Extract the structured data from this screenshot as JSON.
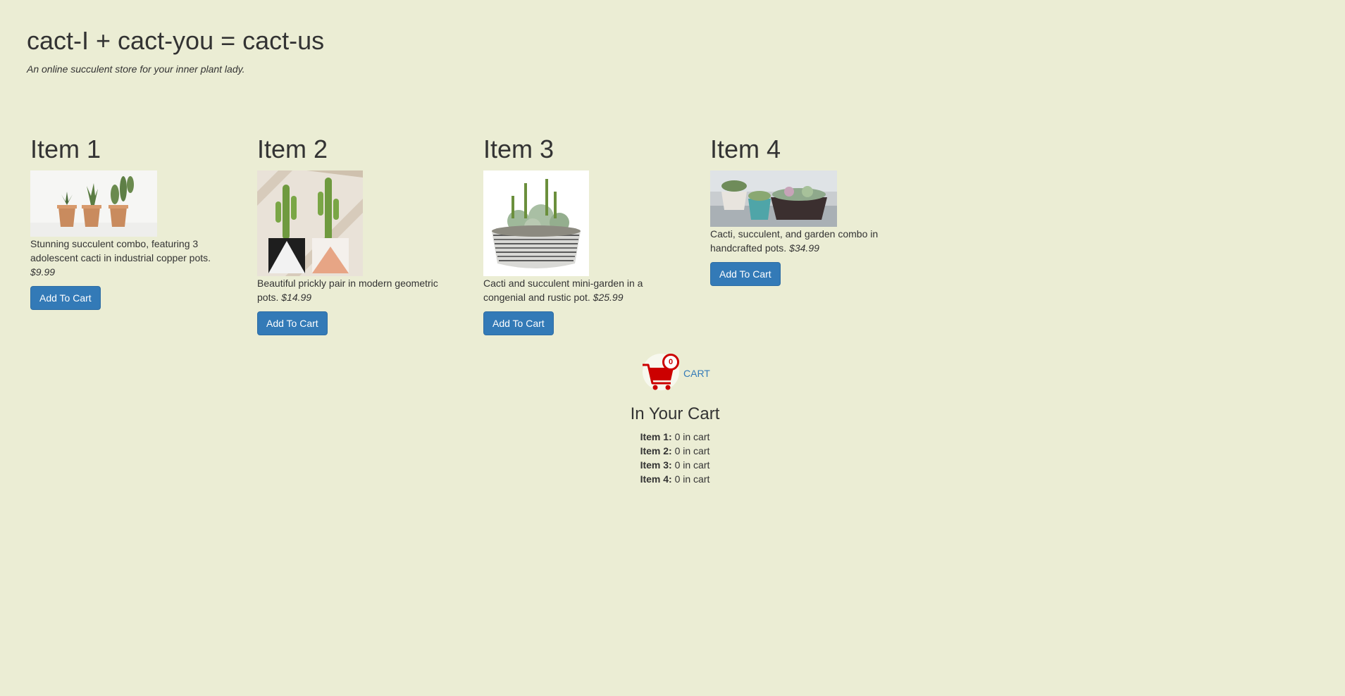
{
  "header": {
    "title": "cact-I + cact-you = cact-us",
    "tagline": "An online succulent store for your inner plant lady."
  },
  "products": [
    {
      "title": "Item 1",
      "description": "Stunning succulent combo, featuring 3 adolescent cacti in industrial copper pots.",
      "price": "$9.99",
      "button_label": "Add To Cart"
    },
    {
      "title": "Item 2",
      "description": "Beautiful prickly pair in modern geometric pots.",
      "price": "$14.99",
      "button_label": "Add To Cart"
    },
    {
      "title": "Item 3",
      "description": "Cacti and succulent mini-garden in a congenial and rustic pot.",
      "price": "$25.99",
      "button_label": "Add To Cart"
    },
    {
      "title": "Item 4",
      "description": "Cacti, succulent, and garden combo in handcrafted pots.",
      "price": "$34.99",
      "button_label": "Add To Cart"
    }
  ],
  "cart": {
    "count": "0",
    "link_label": "CART",
    "icon": "shopping-cart-icon",
    "accent_color": "#cc0000"
  },
  "cart_summary": {
    "heading": "In Your Cart",
    "lines": [
      {
        "label": "Item 1:",
        "value": "0 in cart"
      },
      {
        "label": "Item 2:",
        "value": "0 in cart"
      },
      {
        "label": "Item 3:",
        "value": "0 in cart"
      },
      {
        "label": "Item 4:",
        "value": "0 in cart"
      }
    ]
  },
  "colors": {
    "background": "#ebedd4",
    "button": "#337ab7",
    "text": "#333333"
  }
}
